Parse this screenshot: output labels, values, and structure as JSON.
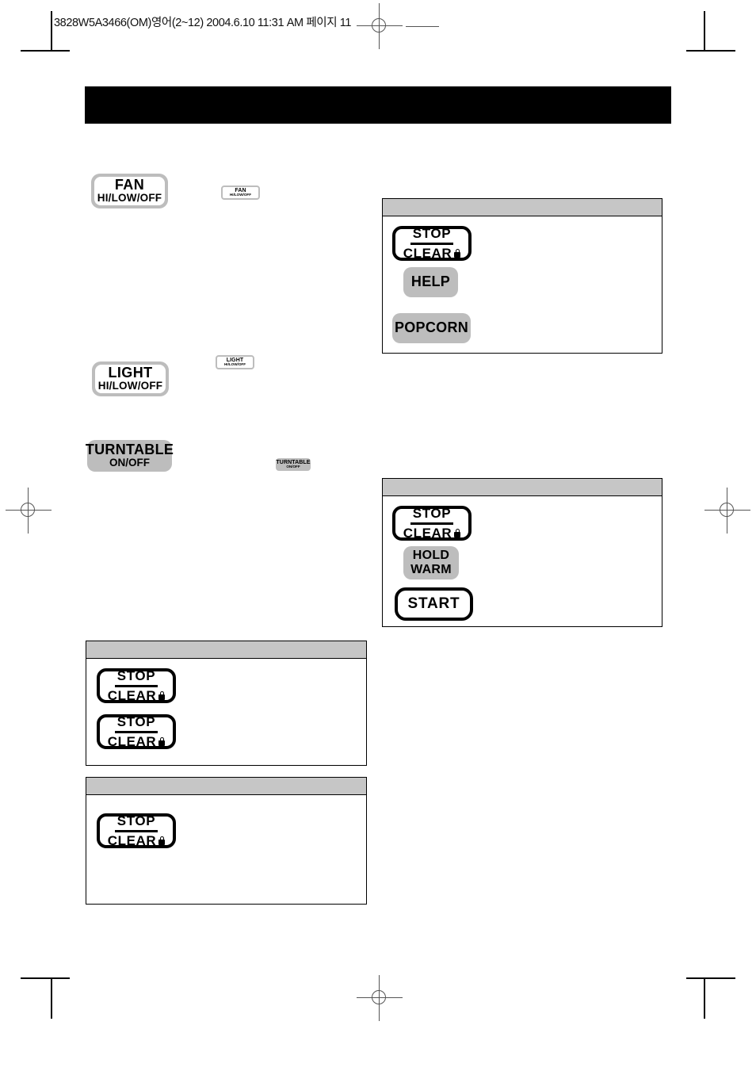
{
  "page": {
    "slug_line": "3828W5A3466(OM)영어(2~12)  2004.6.10 11:31 AM 페이지 11",
    "page_number": "11",
    "banner_title": ""
  },
  "colors": {
    "key_gray": "#bdbdbd",
    "panel_head_gray": "#c6c6c6",
    "banner_black": "#000000",
    "page_white": "#ffffff"
  },
  "keys": {
    "fan": {
      "line1": "FAN",
      "line2": "HI/LOW/OFF",
      "mini_line1": "FAN",
      "mini_line2": "HI/LOW/OFF"
    },
    "light": {
      "line1": "LIGHT",
      "line2": "HI/LOW/OFF",
      "mini_line1": "LIGHT",
      "mini_line2": "HI/LOW/OFF"
    },
    "turntable": {
      "line1": "TURNTABLE",
      "line2": "ON/OFF",
      "mini_line1": "TURNTABLE",
      "mini_line2": "ON/OFF"
    },
    "stop_clear": {
      "top": "STOP",
      "bottom": "CLEAR",
      "lock_icon": "lock-icon"
    },
    "help": {
      "label": "HELP"
    },
    "popcorn": {
      "label": "POPCORN"
    },
    "hold_warm": {
      "line1": "HOLD",
      "line2": "WARM"
    },
    "start": {
      "label": "START"
    }
  },
  "panels": [
    {
      "id": "panel-help-popcorn",
      "heading": "",
      "body_text": "",
      "keys": [
        "stop_clear",
        "help",
        "popcorn"
      ]
    },
    {
      "id": "panel-hold-warm-start",
      "heading": "",
      "body_text": "",
      "keys": [
        "stop_clear",
        "hold_warm",
        "start"
      ]
    },
    {
      "id": "panel-stop-clear-pair",
      "heading": "",
      "body_text": "",
      "keys": [
        "stop_clear",
        "stop_clear"
      ]
    },
    {
      "id": "panel-stop-clear-single",
      "heading": "",
      "body_text": "",
      "keys": [
        "stop_clear"
      ]
    }
  ]
}
